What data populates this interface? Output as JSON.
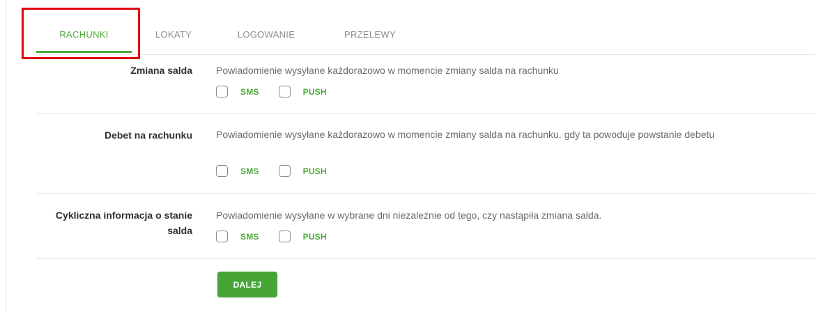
{
  "tabs": [
    {
      "label": "RACHUNKI",
      "active": true
    },
    {
      "label": "LOKATY",
      "active": false
    },
    {
      "label": "LOGOWANIE",
      "active": false
    },
    {
      "label": "PRZELEWY",
      "active": false
    }
  ],
  "rows": [
    {
      "label": "Zmiana salda",
      "description": "Powiadomienie wysyłane każdorazowo w momencie zmiany salda na rachunku",
      "options": [
        {
          "label": "SMS",
          "checked": false
        },
        {
          "label": "PUSH",
          "checked": false
        }
      ]
    },
    {
      "label": "Debet na rachunku",
      "description": "Powiadomienie wysyłane każdorazowo w momencie zmiany salda na rachunku, gdy ta powoduje powstanie debetu",
      "options": [
        {
          "label": "SMS",
          "checked": false
        },
        {
          "label": "PUSH",
          "checked": false
        }
      ]
    },
    {
      "label": "Cykliczna informacja o stanie salda",
      "description": "Powiadomienie wysyłane w wybrane dni niezależnie od tego, czy nastąpiła zmiana salda.",
      "options": [
        {
          "label": "SMS",
          "checked": false
        },
        {
          "label": "PUSH",
          "checked": false
        }
      ]
    }
  ],
  "actions": {
    "next_label": "DALEJ"
  },
  "colors": {
    "accent": "#4cab3a",
    "button": "#46a535",
    "highlight": "#e3000f"
  }
}
